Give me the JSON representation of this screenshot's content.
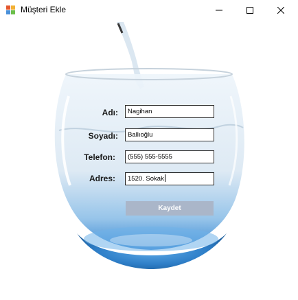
{
  "window": {
    "title": "Müşteri Ekle"
  },
  "form": {
    "ad_label": "Adı:",
    "ad_value": "Nagihan",
    "soyad_label": "Soyadı:",
    "soyad_value": "Ballıoğlu",
    "telefon_label": "Telefon:",
    "telefon_value": "(555) 555-5555",
    "adres_label": "Adres:",
    "adres_value": "1520. Sokak",
    "save_label": "Kaydet"
  },
  "icons": {
    "app": "app-icon",
    "minimize": "minimize-icon",
    "maximize": "maximize-icon",
    "close": "close-icon"
  },
  "colors": {
    "save_button": "#aab6c9",
    "water": "#2f8fd6",
    "glass": "#dfe9f2"
  }
}
